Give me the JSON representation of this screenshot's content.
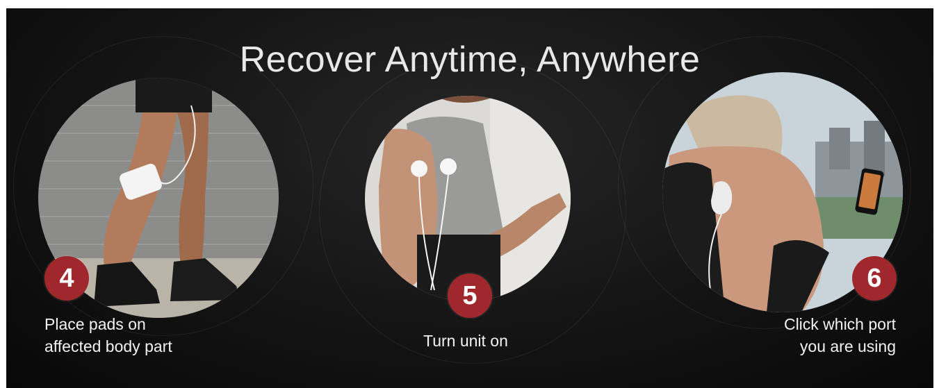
{
  "title": "Recover Anytime, Anywhere",
  "colors": {
    "background": "#141414",
    "badge": "#a0282c",
    "text": "#f2f2f2"
  },
  "steps": [
    {
      "number": "4",
      "caption": "Place pads on\naffected body part",
      "image": "legs-with-pad-photo"
    },
    {
      "number": "5",
      "caption": "Turn unit on",
      "image": "arm-with-pads-photo"
    },
    {
      "number": "6",
      "caption": "Click which port\nyou are using",
      "image": "shoulder-pad-phone-photo"
    }
  ]
}
